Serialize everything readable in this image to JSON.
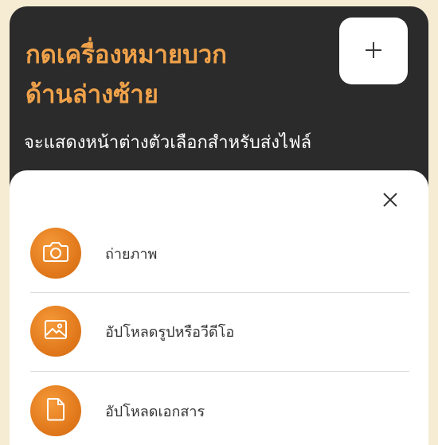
{
  "header": {
    "title_line1": "กดเครื่องหมายบวก",
    "title_line2": "ด้านล่างซ้าย",
    "description": "จะแสดงหน้าต่างตัวเลือกสำหรับส่งไฟล์"
  },
  "sheet": {
    "options": [
      {
        "label": "ถ่ายภาพ",
        "icon": "camera-icon"
      },
      {
        "label": "อัปโหลดรูปหรือวีดีโอ",
        "icon": "image-icon"
      },
      {
        "label": "อัปโหลดเอกสาร",
        "icon": "document-icon"
      }
    ]
  },
  "colors": {
    "page_background": "#f6ecd4",
    "card_background": "#2b2b2b",
    "accent_text": "#f0a24a",
    "option_circle": "#e8821f"
  }
}
